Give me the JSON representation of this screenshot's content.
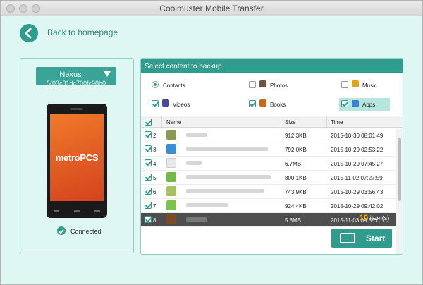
{
  "window": {
    "title": "Coolmuster Mobile Transfer"
  },
  "nav": {
    "back_label": "Back to homepage"
  },
  "device": {
    "name": "Nexus",
    "serial": "5(03c31dc700fc98b0",
    "status": "Connected",
    "phone_logo": "metroPCS"
  },
  "content": {
    "header": "Select content to backup",
    "categories": [
      {
        "label": "Contacts",
        "icon": "contacts-icon",
        "selected": true
      },
      {
        "label": "Photos",
        "icon": "photos-icon",
        "selected": false
      },
      {
        "label": "Music",
        "icon": "music-icon",
        "selected": false
      },
      {
        "label": "Videos",
        "icon": "videos-icon",
        "selected": true
      },
      {
        "label": "Books",
        "icon": "books-icon",
        "selected": true
      },
      {
        "label": "Apps",
        "icon": "apps-icon",
        "selected": true
      }
    ]
  },
  "table": {
    "columns": [
      "Name",
      "Size",
      "Time"
    ],
    "rows": [
      {
        "num": "2",
        "size": "912.3KB",
        "time": "2015-10-30 08:01:49"
      },
      {
        "num": "3",
        "size": "792.0KB",
        "time": "2015-10-29 02:53:22"
      },
      {
        "num": "4",
        "size": "6.7MB",
        "time": "2015-10-29 07:45:27"
      },
      {
        "num": "5",
        "size": "800.1KB",
        "time": "2015-11-02 07:27:59"
      },
      {
        "num": "6",
        "size": "743.9KB",
        "time": "2015-10-29 03:56:43"
      },
      {
        "num": "7",
        "size": "924.4KB",
        "time": "2015-10-29 09:42:02"
      },
      {
        "num": "8",
        "size": "5.8MB",
        "time": "2015-11-03 09:55:01"
      }
    ]
  },
  "footer": {
    "count": "10",
    "count_suffix": " item(s)",
    "start_label": "Start"
  },
  "colors": {
    "accent": "#2f9c8d",
    "panel_bg": "#dff7f3",
    "count_highlight": "#ffb300"
  }
}
